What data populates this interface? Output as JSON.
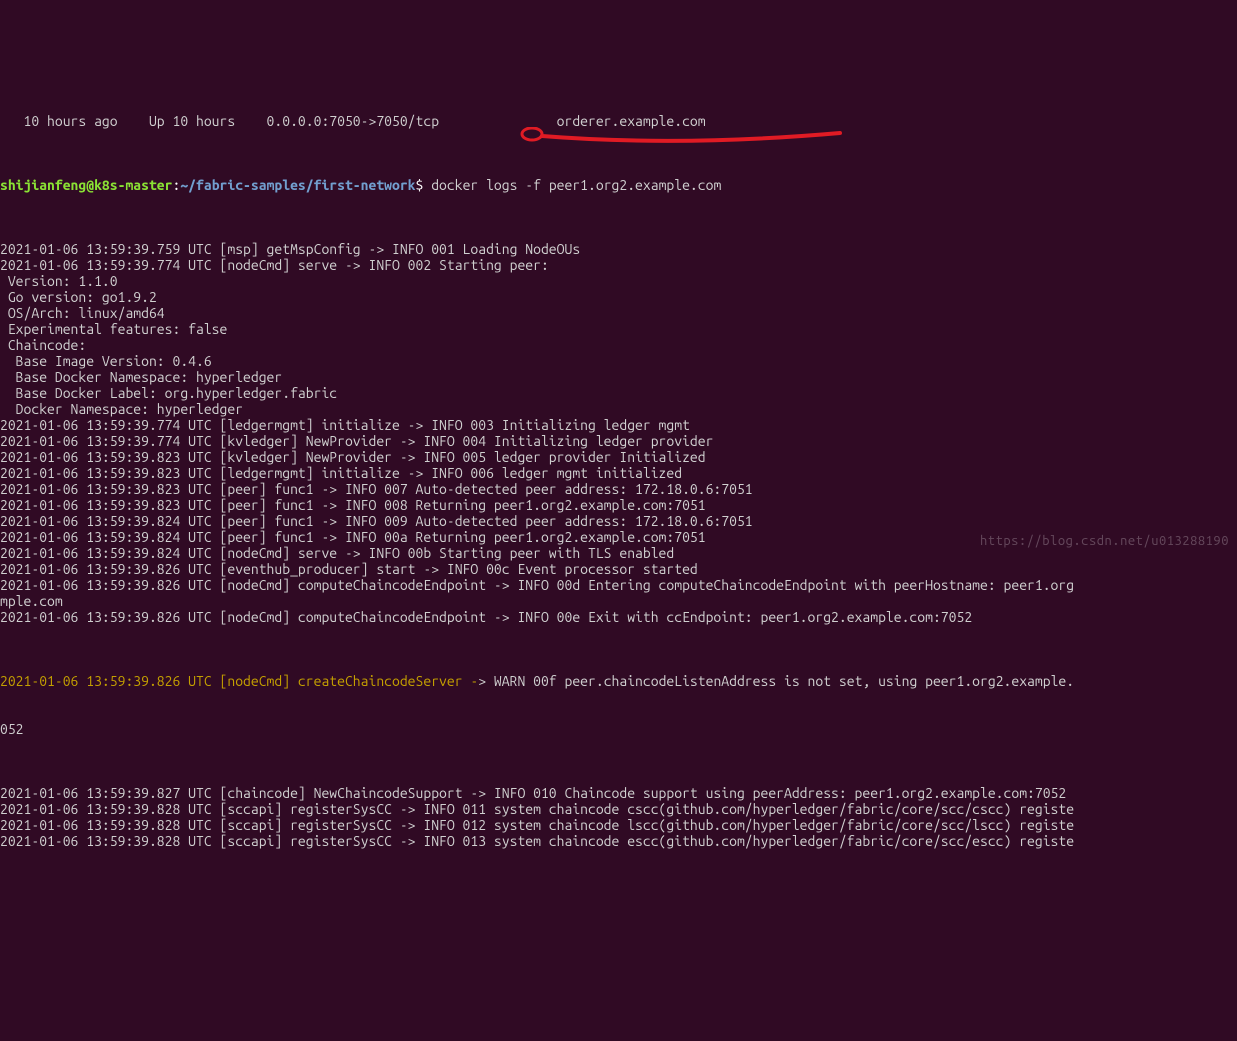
{
  "top_fragment": "   10 hours ago    Up 10 hours    0.0.0.0:7050->7050/tcp               orderer.example.com",
  "prompt": {
    "user_host": "shijianfeng@k8s-master",
    "sep": ":",
    "path": "~/fabric-samples/first-network",
    "dollar": "$",
    "command": " docker logs -f peer1.org2.example.com"
  },
  "log_lines": [
    "2021-01-06 13:59:39.759 UTC [msp] getMspConfig -> INFO 001 Loading NodeOUs",
    "2021-01-06 13:59:39.774 UTC [nodeCmd] serve -> INFO 002 Starting peer:",
    " Version: 1.1.0",
    " Go version: go1.9.2",
    " OS/Arch: linux/amd64",
    " Experimental features: false",
    " Chaincode:",
    "  Base Image Version: 0.4.6",
    "  Base Docker Namespace: hyperledger",
    "  Base Docker Label: org.hyperledger.fabric",
    "  Docker Namespace: hyperledger",
    "",
    "2021-01-06 13:59:39.774 UTC [ledgermgmt] initialize -> INFO 003 Initializing ledger mgmt",
    "2021-01-06 13:59:39.774 UTC [kvledger] NewProvider -> INFO 004 Initializing ledger provider",
    "2021-01-06 13:59:39.823 UTC [kvledger] NewProvider -> INFO 005 ledger provider Initialized",
    "2021-01-06 13:59:39.823 UTC [ledgermgmt] initialize -> INFO 006 ledger mgmt initialized",
    "2021-01-06 13:59:39.823 UTC [peer] func1 -> INFO 007 Auto-detected peer address: 172.18.0.6:7051",
    "2021-01-06 13:59:39.823 UTC [peer] func1 -> INFO 008 Returning peer1.org2.example.com:7051",
    "2021-01-06 13:59:39.824 UTC [peer] func1 -> INFO 009 Auto-detected peer address: 172.18.0.6:7051",
    "2021-01-06 13:59:39.824 UTC [peer] func1 -> INFO 00a Returning peer1.org2.example.com:7051",
    "2021-01-06 13:59:39.824 UTC [nodeCmd] serve -> INFO 00b Starting peer with TLS enabled",
    "2021-01-06 13:59:39.826 UTC [eventhub_producer] start -> INFO 00c Event processor started",
    "2021-01-06 13:59:39.826 UTC [nodeCmd] computeChaincodeEndpoint -> INFO 00d Entering computeChaincodeEndpoint with peerHostname: peer1.org",
    "mple.com",
    "2021-01-06 13:59:39.826 UTC [nodeCmd] computeChaincodeEndpoint -> INFO 00e Exit with ccEndpoint: peer1.org2.example.com:7052"
  ],
  "warn_line": "2021-01-06 13:59:39.826 UTC [nodeCmd] createChaincodeServer -> WARN 00f peer.chaincodeListenAddress is not set, using peer1.org2.example.",
  "warn_extra": "052",
  "post_warn_lines": [
    "2021-01-06 13:59:39.827 UTC [chaincode] NewChaincodeSupport -> INFO 010 Chaincode support using peerAddress: peer1.org2.example.com:7052",
    "2021-01-06 13:59:39.828 UTC [sccapi] registerSysCC -> INFO 011 system chaincode cscc(github.com/hyperledger/fabric/core/scc/cscc) registe",
    "2021-01-06 13:59:39.828 UTC [sccapi] registerSysCC -> INFO 012 system chaincode lscc(github.com/hyperledger/fabric/core/scc/lscc) registe",
    "2021-01-06 13:59:39.828 UTC [sccapi] registerSysCC -> INFO 013 system chaincode escc(github.com/hyperledger/fabric/core/scc/escc) registe"
  ],
  "watermark": "https://blog.csdn.net/u013288190",
  "warn_prefix_len": 61
}
